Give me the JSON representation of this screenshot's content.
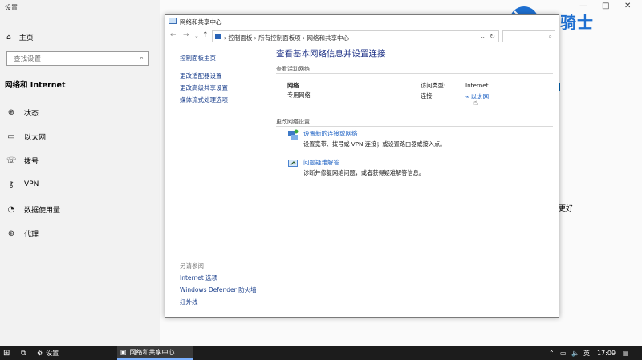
{
  "settings": {
    "window_title": "设置",
    "home_label": "主页",
    "search_placeholder": "查找设置",
    "section_title": "网络和 Internet",
    "items": [
      {
        "label": "状态",
        "icon": "globe-icon"
      },
      {
        "label": "以太网",
        "icon": "ethernet-icon"
      },
      {
        "label": "拨号",
        "icon": "dialup-icon"
      },
      {
        "label": "VPN",
        "icon": "vpn-icon"
      },
      {
        "label": "数据使用量",
        "icon": "data-usage-icon"
      },
      {
        "label": "代理",
        "icon": "proxy-globe-icon"
      }
    ],
    "background_fragment": "更好"
  },
  "logo": {
    "text": "云骑士",
    "color": "#1e6fd0"
  },
  "nsc": {
    "window_title": "网络和共享中心",
    "breadcrumb": [
      "控制面板",
      "所有控制面板项",
      "网络和共享中心"
    ],
    "left_links": [
      "控制面板主页",
      "更改适配器设置",
      "更改高级共享设置",
      "媒体流式处理选项"
    ],
    "see_also_title": "另请参阅",
    "see_also_links": [
      "Internet 选项",
      "Windows Defender 防火墙",
      "红外线"
    ],
    "main_title": "查看基本网络信息并设置连接",
    "active_networks_label": "查看活动网络",
    "network_name": "网络",
    "network_type": "专用网络",
    "access_type_label": "访问类型:",
    "access_type_value": "Internet",
    "connection_label": "连接:",
    "connection_value": "以太网",
    "change_settings_label": "更改网络设置",
    "tasks": [
      {
        "title": "设置新的连接或网络",
        "desc": "设置宽带、拨号或 VPN 连接；或设置路由器或接入点。"
      },
      {
        "title": "问题疑难解答",
        "desc": "诊断并修复网络问题，或者获得疑难解答信息。"
      }
    ]
  },
  "taskbar": {
    "settings_app_label": "设置",
    "nsc_task_label": "网络和共享中心",
    "ime_label": "英",
    "time": "17:09"
  },
  "colors": {
    "accent": "#0063b1",
    "link": "#1e62c4",
    "title_blue": "#1e3287",
    "taskbar": "#1c1c1c"
  }
}
